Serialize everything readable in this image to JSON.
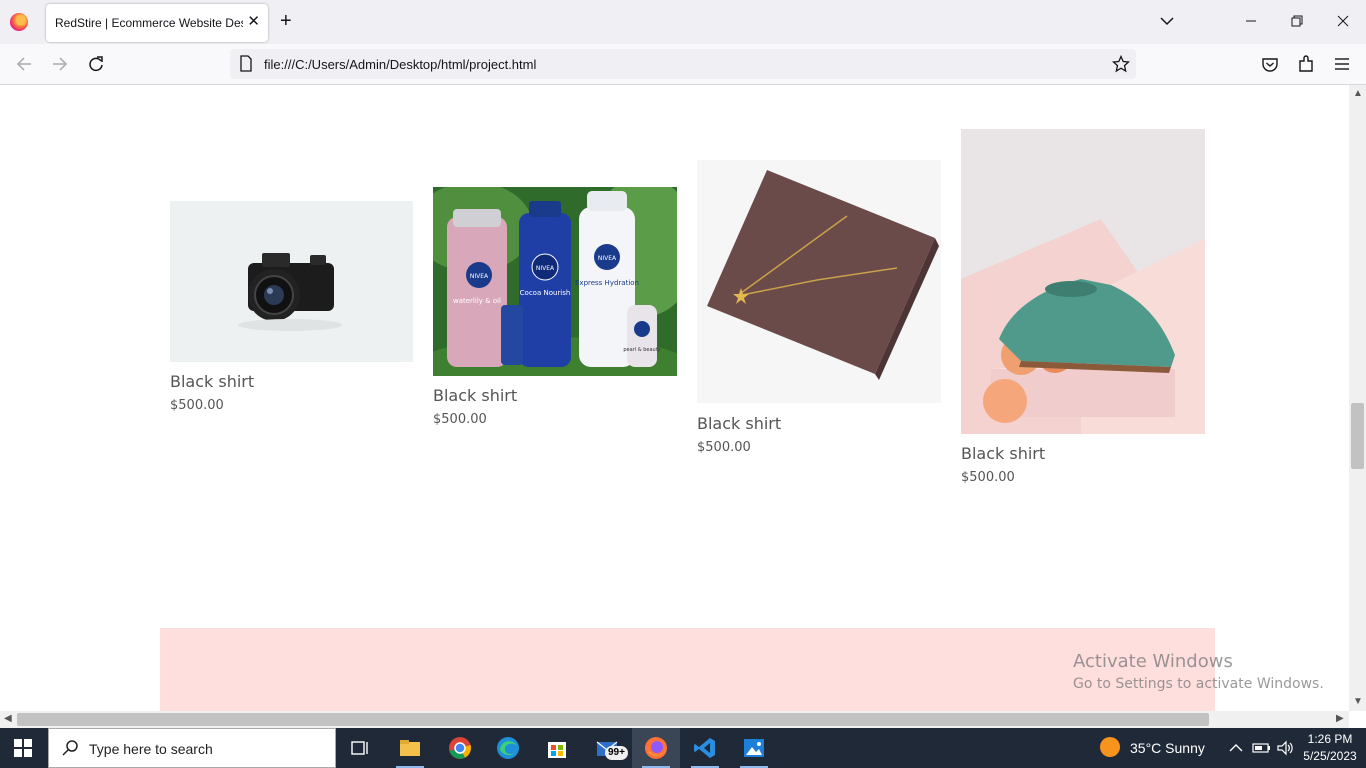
{
  "browser": {
    "tab_title": "RedStire | Ecommerce Website Design",
    "url": "file:///C:/Users/Admin/Desktop/html/project.html"
  },
  "products": [
    {
      "name": "Black shirt",
      "price": "$500.00",
      "image": "camera"
    },
    {
      "name": "Black shirt",
      "price": "$500.00",
      "image": "nivea-products"
    },
    {
      "name": "Black shirt",
      "price": "$500.00",
      "image": "necklace-on-box"
    },
    {
      "name": "Black shirt",
      "price": "$500.00",
      "image": "green-shoe"
    }
  ],
  "watermark": {
    "title": "Activate Windows",
    "subtitle": "Go to Settings to activate Windows."
  },
  "nivea_labels": {
    "brand": "NIVEA",
    "waterlily": "waterlily & oil",
    "cocoa": "Cocoa Nourish",
    "express": "Express Hydration",
    "pearl": "pearl & beauty"
  },
  "taskbar": {
    "search_placeholder": "Type here to search",
    "mail_badge": "99+",
    "weather": "35°C  Sunny",
    "time": "1:26 PM",
    "date": "5/25/2023"
  },
  "colors": {
    "banner": "#ffdede",
    "taskbar": "#202938"
  }
}
